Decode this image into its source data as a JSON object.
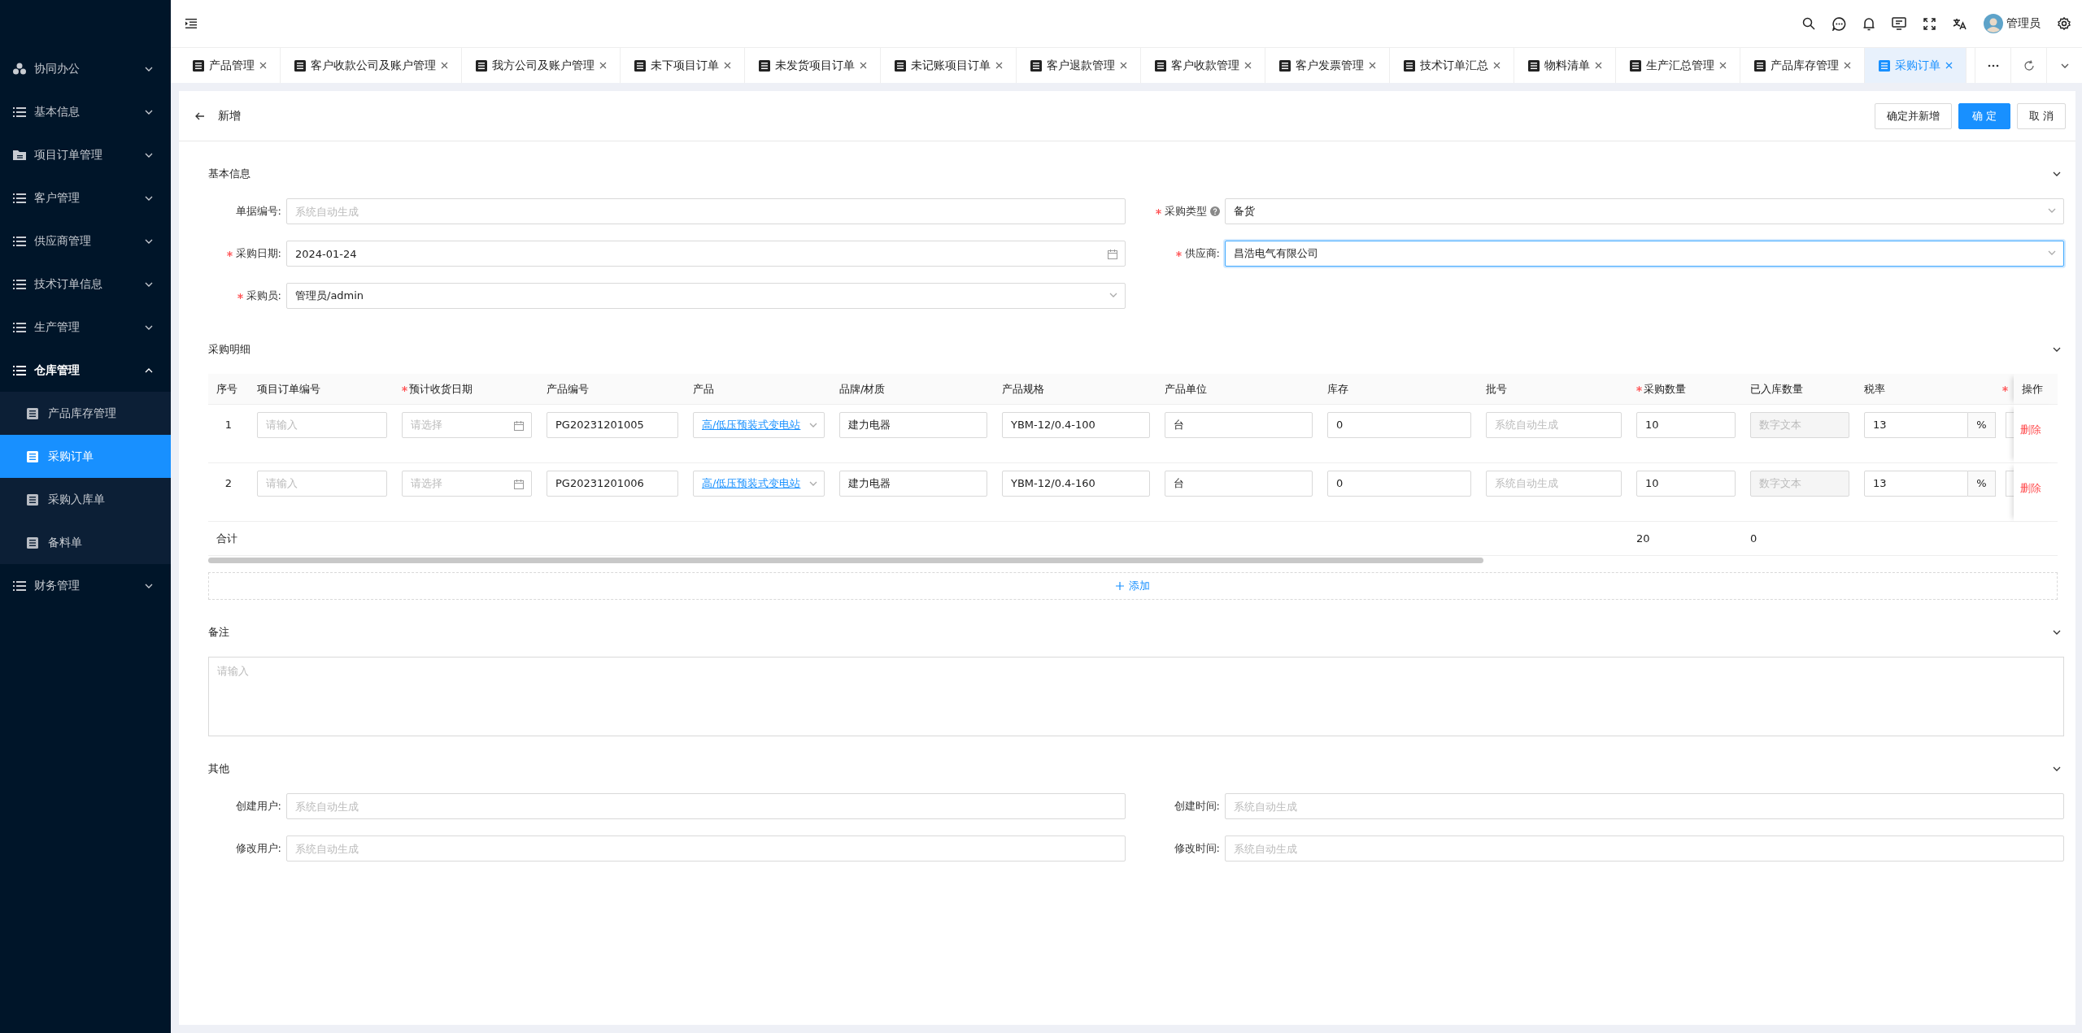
{
  "sidebar": {
    "items": [
      {
        "label": "协同办公",
        "expanded": false
      },
      {
        "label": "基本信息",
        "expanded": false
      },
      {
        "label": "项目订单管理",
        "expanded": false
      },
      {
        "label": "客户管理",
        "expanded": false
      },
      {
        "label": "供应商管理",
        "expanded": false
      },
      {
        "label": "技术订单信息",
        "expanded": false
      },
      {
        "label": "生产管理",
        "expanded": false
      },
      {
        "label": "仓库管理",
        "expanded": true,
        "children": [
          {
            "label": "产品库存管理",
            "selected": false
          },
          {
            "label": "采购订单",
            "selected": true
          },
          {
            "label": "采购入库单",
            "selected": false
          },
          {
            "label": "备料单",
            "selected": false
          }
        ]
      },
      {
        "label": "财务管理",
        "expanded": false
      }
    ]
  },
  "header": {
    "user": "管理员"
  },
  "tabs": [
    {
      "label": "产品管理",
      "selected": false
    },
    {
      "label": "客户收款公司及账户管理",
      "selected": false
    },
    {
      "label": "我方公司及账户管理",
      "selected": false
    },
    {
      "label": "未下项目订单",
      "selected": false
    },
    {
      "label": "未发货项目订单",
      "selected": false
    },
    {
      "label": "未记账项目订单",
      "selected": false
    },
    {
      "label": "客户退款管理",
      "selected": false
    },
    {
      "label": "客户收款管理",
      "selected": false
    },
    {
      "label": "客户发票管理",
      "selected": false
    },
    {
      "label": "技术订单汇总",
      "selected": false
    },
    {
      "label": "物料清单",
      "selected": false
    },
    {
      "label": "生产汇总管理",
      "selected": false
    },
    {
      "label": "产品库存管理",
      "selected": false
    },
    {
      "label": "采购订单",
      "selected": true
    }
  ],
  "page": {
    "title": "新增",
    "buttons": [
      {
        "label": "确定并新增",
        "kind": "default"
      },
      {
        "label": "确 定",
        "kind": "primary"
      },
      {
        "label": "取 消",
        "kind": "default"
      }
    ]
  },
  "sections": [
    {
      "kind": "form",
      "title": "基本信息",
      "expanded": true,
      "fields": [
        {
          "label": "单据编号:",
          "kind": "text",
          "placeholder": "系统自动生成",
          "focused": false
        },
        {
          "label": "采购类型",
          "required": true,
          "help": true,
          "kind": "select",
          "value": "备货",
          "focused": false
        },
        {
          "label": "采购日期:",
          "required": true,
          "kind": "date",
          "value": "2024-01-24",
          "focused": false
        },
        {
          "label": "供应商:",
          "required": true,
          "kind": "select",
          "value": "昌浩电气有限公司",
          "focused": true
        },
        {
          "label": "采购员:",
          "required": true,
          "kind": "select",
          "value": "管理员/admin",
          "focused": false
        }
      ]
    },
    {
      "kind": "table",
      "title": "采购明细",
      "expanded": true,
      "columns": [
        {
          "label": "序号"
        },
        {
          "label": "项目订单编号"
        },
        {
          "label": "预计收货日期",
          "required": true
        },
        {
          "label": "产品编号"
        },
        {
          "label": "产品"
        },
        {
          "label": "品牌/材质"
        },
        {
          "label": "产品规格"
        },
        {
          "label": "产品单位"
        },
        {
          "label": "库存"
        },
        {
          "label": "批号"
        },
        {
          "label": "采购数量",
          "required": true,
          "total": "20"
        },
        {
          "label": "已入库数量",
          "total": "0"
        },
        {
          "label": "税率"
        },
        {
          "required": true
        },
        {
          "label": "操作"
        }
      ],
      "rows": [
        {
          "cells": [
            {
              "kind": "text",
              "value": "1"
            },
            {
              "kind": "input",
              "placeholder": "请输入"
            },
            {
              "kind": "date",
              "placeholder": "请选择"
            },
            {
              "kind": "input",
              "value": "PG20231201005"
            },
            {
              "kind": "link_select",
              "value": "高/低压预装式变电站"
            },
            {
              "kind": "input",
              "value": "建力电器"
            },
            {
              "kind": "input",
              "value": "YBM-12/0.4-100"
            },
            {
              "kind": "input",
              "value": "台"
            },
            {
              "kind": "input",
              "value": "0"
            },
            {
              "kind": "input",
              "placeholder": "系统自动生成"
            },
            {
              "kind": "input",
              "value": "10"
            },
            {
              "kind": "disabled",
              "placeholder": "数字文本"
            },
            {
              "kind": "suffix",
              "value": "13",
              "suffix": "%"
            },
            {
              "kind": "clipped"
            },
            {
              "kind": "link",
              "value": "删除"
            }
          ]
        },
        {
          "cells": [
            {
              "kind": "text",
              "value": "2"
            },
            {
              "kind": "input",
              "placeholder": "请输入"
            },
            {
              "kind": "date",
              "placeholder": "请选择"
            },
            {
              "kind": "input",
              "value": "PG20231201006"
            },
            {
              "kind": "link_select",
              "value": "高/低压预装式变电站"
            },
            {
              "kind": "input",
              "value": "建力电器"
            },
            {
              "kind": "input",
              "value": "YBM-12/0.4-160"
            },
            {
              "kind": "input",
              "value": "台"
            },
            {
              "kind": "input",
              "value": "0"
            },
            {
              "kind": "input",
              "placeholder": "系统自动生成"
            },
            {
              "kind": "input",
              "value": "10"
            },
            {
              "kind": "disabled",
              "placeholder": "数字文本"
            },
            {
              "kind": "suffix",
              "value": "13",
              "suffix": "%"
            },
            {
              "kind": "clipped"
            },
            {
              "kind": "link",
              "value": "删除"
            }
          ]
        }
      ],
      "total_label": "合计",
      "add_label": "添加"
    },
    {
      "kind": "textarea",
      "title": "备注",
      "expanded": true,
      "placeholder": "请输入"
    },
    {
      "kind": "form",
      "title": "其他",
      "expanded": true,
      "fields": [
        {
          "label": "创建用户:",
          "kind": "text",
          "placeholder": "系统自动生成",
          "focused": false
        },
        {
          "label": "创建时间:",
          "kind": "text",
          "placeholder": "系统自动生成",
          "focused": false
        },
        {
          "label": "修改用户:",
          "kind": "text",
          "placeholder": "系统自动生成",
          "focused": false
        },
        {
          "label": "修改时间:",
          "kind": "text",
          "placeholder": "系统自动生成",
          "focused": false
        }
      ]
    }
  ]
}
